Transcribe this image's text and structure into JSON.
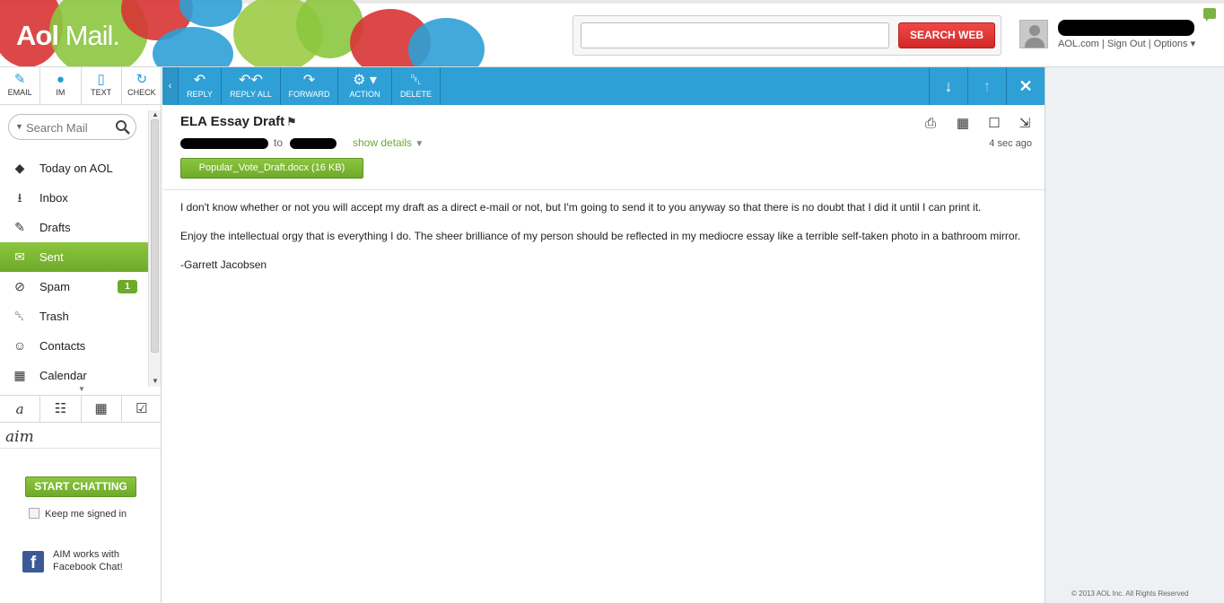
{
  "header": {
    "logo_bold": "Aol",
    "logo_light": "Mail.",
    "search_value": "",
    "search_button": "SEARCH WEB",
    "account_links": [
      "AOL.com",
      "Sign Out",
      "Options"
    ],
    "separator": " | ",
    "options_caret": "▾"
  },
  "compose": [
    {
      "label": "EMAIL",
      "icon": "compose-icon",
      "glyph": "✎"
    },
    {
      "label": "IM",
      "icon": "chat-bubble-icon",
      "glyph": "●"
    },
    {
      "label": "TEXT",
      "icon": "phone-icon",
      "glyph": "▯"
    },
    {
      "label": "CHECK",
      "icon": "refresh-icon",
      "glyph": "↻"
    }
  ],
  "search_mail": {
    "placeholder": "Search Mail"
  },
  "folders": [
    {
      "label": "Today on AOL",
      "icon": "aol-icon",
      "glyph": "◆",
      "count": ""
    },
    {
      "label": "Inbox",
      "icon": "inbox-icon",
      "glyph": "⭳",
      "count": ""
    },
    {
      "label": "Drafts",
      "icon": "drafts-icon",
      "glyph": "✎",
      "count": ""
    },
    {
      "label": "Sent",
      "icon": "sent-icon",
      "glyph": "✉",
      "count": ""
    },
    {
      "label": "Spam",
      "icon": "spam-icon",
      "glyph": "⊘",
      "count": "1"
    },
    {
      "label": "Trash",
      "icon": "trash-icon",
      "glyph": "␡",
      "count": ""
    },
    {
      "label": "Contacts",
      "icon": "contacts-icon",
      "glyph": "☺",
      "count": ""
    },
    {
      "label": "Calendar",
      "icon": "calendar-icon",
      "glyph": "▦",
      "count": ""
    }
  ],
  "active_folder": "Sent",
  "bottom_tabs": [
    "a",
    "☷",
    "▦",
    "☑"
  ],
  "aim": {
    "logo": "aim",
    "start_button": "START CHATTING",
    "keep_signed": "Keep me signed in",
    "fb_text": "AIM works with Facebook Chat!",
    "fb_letter": "f"
  },
  "toolbar": {
    "collapse": "‹",
    "buttons": [
      {
        "label": "REPLY",
        "icon": "reply-icon",
        "glyph": "↶"
      },
      {
        "label": "REPLY ALL",
        "icon": "reply-all-icon",
        "glyph": "↶↶"
      },
      {
        "label": "FORWARD",
        "icon": "forward-icon",
        "glyph": "↷"
      },
      {
        "label": "ACTION",
        "icon": "gear-icon",
        "glyph": "⚙ ▾"
      },
      {
        "label": "DELETE",
        "icon": "trash-icon",
        "glyph": "␡"
      }
    ],
    "right": [
      {
        "icon": "arrow-down-icon",
        "glyph": "↓"
      },
      {
        "icon": "arrow-up-icon",
        "glyph": "↑"
      },
      {
        "icon": "close-icon",
        "glyph": "✕"
      }
    ]
  },
  "message": {
    "subject": "ELA Essay Draft",
    "flag_glyph": "⚑",
    "to_label": "to",
    "show_details": "show details",
    "attachment": "Popular_Vote_Draft.docx (16 KB)",
    "timestamp": "4 sec ago",
    "actions": [
      {
        "icon": "print-icon",
        "glyph": "⎙"
      },
      {
        "icon": "calendar-add-icon",
        "glyph": "▦"
      },
      {
        "icon": "task-icon",
        "glyph": "☐"
      },
      {
        "icon": "popout-icon",
        "glyph": "⇲"
      }
    ],
    "body": [
      "I don't know whether or not you will accept my draft as a direct e-mail or not, but I'm going to send it to you anyway so that there is no doubt that I did it until I can print it.",
      "Enjoy the intellectual orgy that is everything I do. The sheer brilliance of my person should be reflected in my mediocre essay like a terrible self-taken photo in a bathroom mirror.",
      "-Garrett Jacobsen"
    ]
  },
  "footer": {
    "copyright": "© 2013 AOL Inc. All Rights Reserved"
  },
  "colors": {
    "accent_blue": "#2ea0d6",
    "accent_green": "#7cb342",
    "search_red": "#e03a3a"
  }
}
